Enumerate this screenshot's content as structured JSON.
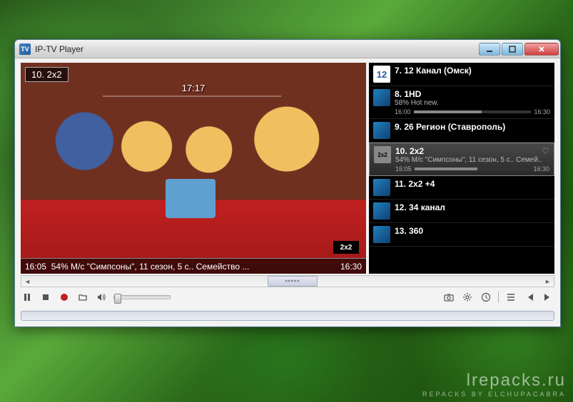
{
  "window": {
    "title": "IP-TV Player",
    "app_icon_label": "TV"
  },
  "video": {
    "channel_label": "10. 2x2",
    "live_time": "17:17",
    "network_badge": "2x2",
    "bar": {
      "start": "16:05",
      "info": "54% М/с \"Симпсоны\", 11 сезон, 5 с.. Семейство ...",
      "end": "16:30"
    }
  },
  "channels": [
    {
      "title": "7. 12 Канал (Омск)",
      "sub": "",
      "start": "",
      "end": "",
      "icon": "12",
      "iconcls": "white-logo"
    },
    {
      "title": "8. 1HD",
      "sub": "58% Hot new.",
      "start": "16:00",
      "end": "16:30",
      "pct": "58%"
    },
    {
      "title": "9. 26 Регион (Ставрополь)",
      "sub": ""
    },
    {
      "title": "10. 2x2",
      "sub": "54% М/с \"Симпсоны\", 11 сезон, 5 с.. Семей..",
      "start": "16:05",
      "end": "16:30",
      "pct": "54%",
      "icon": "2x2",
      "iconcls": "gray-logo",
      "selected": true,
      "fav": "♡"
    },
    {
      "title": "11. 2x2 +4",
      "sub": ""
    },
    {
      "title": "12. 34 канал",
      "sub": ""
    },
    {
      "title": "13. 360",
      "sub": ""
    }
  ],
  "watermark": {
    "line1": "lrepacks.ru",
    "line2": "REPACKS BY ELCHUPACABRA"
  }
}
